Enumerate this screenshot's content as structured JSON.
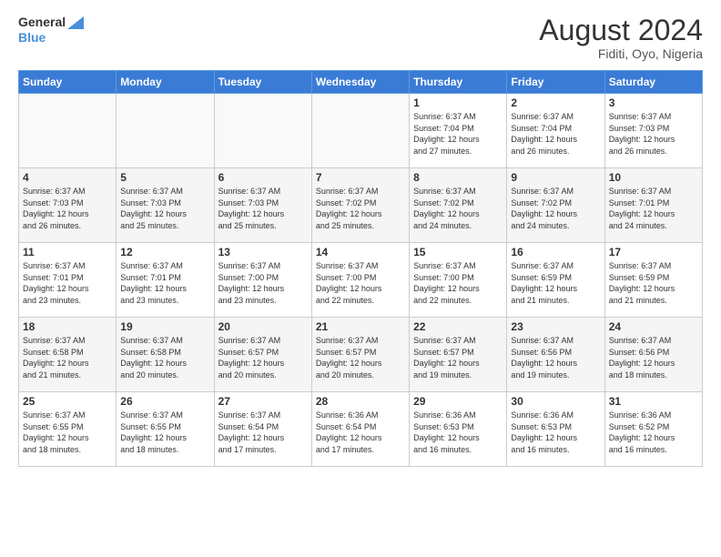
{
  "header": {
    "logo_line1": "General",
    "logo_line2": "Blue",
    "month_year": "August 2024",
    "location": "Fiditi, Oyo, Nigeria"
  },
  "weekdays": [
    "Sunday",
    "Monday",
    "Tuesday",
    "Wednesday",
    "Thursday",
    "Friday",
    "Saturday"
  ],
  "weeks": [
    [
      {
        "day": "",
        "info": ""
      },
      {
        "day": "",
        "info": ""
      },
      {
        "day": "",
        "info": ""
      },
      {
        "day": "",
        "info": ""
      },
      {
        "day": "1",
        "info": "Sunrise: 6:37 AM\nSunset: 7:04 PM\nDaylight: 12 hours\nand 27 minutes."
      },
      {
        "day": "2",
        "info": "Sunrise: 6:37 AM\nSunset: 7:04 PM\nDaylight: 12 hours\nand 26 minutes."
      },
      {
        "day": "3",
        "info": "Sunrise: 6:37 AM\nSunset: 7:03 PM\nDaylight: 12 hours\nand 26 minutes."
      }
    ],
    [
      {
        "day": "4",
        "info": "Sunrise: 6:37 AM\nSunset: 7:03 PM\nDaylight: 12 hours\nand 26 minutes."
      },
      {
        "day": "5",
        "info": "Sunrise: 6:37 AM\nSunset: 7:03 PM\nDaylight: 12 hours\nand 25 minutes."
      },
      {
        "day": "6",
        "info": "Sunrise: 6:37 AM\nSunset: 7:03 PM\nDaylight: 12 hours\nand 25 minutes."
      },
      {
        "day": "7",
        "info": "Sunrise: 6:37 AM\nSunset: 7:02 PM\nDaylight: 12 hours\nand 25 minutes."
      },
      {
        "day": "8",
        "info": "Sunrise: 6:37 AM\nSunset: 7:02 PM\nDaylight: 12 hours\nand 24 minutes."
      },
      {
        "day": "9",
        "info": "Sunrise: 6:37 AM\nSunset: 7:02 PM\nDaylight: 12 hours\nand 24 minutes."
      },
      {
        "day": "10",
        "info": "Sunrise: 6:37 AM\nSunset: 7:01 PM\nDaylight: 12 hours\nand 24 minutes."
      }
    ],
    [
      {
        "day": "11",
        "info": "Sunrise: 6:37 AM\nSunset: 7:01 PM\nDaylight: 12 hours\nand 23 minutes."
      },
      {
        "day": "12",
        "info": "Sunrise: 6:37 AM\nSunset: 7:01 PM\nDaylight: 12 hours\nand 23 minutes."
      },
      {
        "day": "13",
        "info": "Sunrise: 6:37 AM\nSunset: 7:00 PM\nDaylight: 12 hours\nand 23 minutes."
      },
      {
        "day": "14",
        "info": "Sunrise: 6:37 AM\nSunset: 7:00 PM\nDaylight: 12 hours\nand 22 minutes."
      },
      {
        "day": "15",
        "info": "Sunrise: 6:37 AM\nSunset: 7:00 PM\nDaylight: 12 hours\nand 22 minutes."
      },
      {
        "day": "16",
        "info": "Sunrise: 6:37 AM\nSunset: 6:59 PM\nDaylight: 12 hours\nand 21 minutes."
      },
      {
        "day": "17",
        "info": "Sunrise: 6:37 AM\nSunset: 6:59 PM\nDaylight: 12 hours\nand 21 minutes."
      }
    ],
    [
      {
        "day": "18",
        "info": "Sunrise: 6:37 AM\nSunset: 6:58 PM\nDaylight: 12 hours\nand 21 minutes."
      },
      {
        "day": "19",
        "info": "Sunrise: 6:37 AM\nSunset: 6:58 PM\nDaylight: 12 hours\nand 20 minutes."
      },
      {
        "day": "20",
        "info": "Sunrise: 6:37 AM\nSunset: 6:57 PM\nDaylight: 12 hours\nand 20 minutes."
      },
      {
        "day": "21",
        "info": "Sunrise: 6:37 AM\nSunset: 6:57 PM\nDaylight: 12 hours\nand 20 minutes."
      },
      {
        "day": "22",
        "info": "Sunrise: 6:37 AM\nSunset: 6:57 PM\nDaylight: 12 hours\nand 19 minutes."
      },
      {
        "day": "23",
        "info": "Sunrise: 6:37 AM\nSunset: 6:56 PM\nDaylight: 12 hours\nand 19 minutes."
      },
      {
        "day": "24",
        "info": "Sunrise: 6:37 AM\nSunset: 6:56 PM\nDaylight: 12 hours\nand 18 minutes."
      }
    ],
    [
      {
        "day": "25",
        "info": "Sunrise: 6:37 AM\nSunset: 6:55 PM\nDaylight: 12 hours\nand 18 minutes."
      },
      {
        "day": "26",
        "info": "Sunrise: 6:37 AM\nSunset: 6:55 PM\nDaylight: 12 hours\nand 18 minutes."
      },
      {
        "day": "27",
        "info": "Sunrise: 6:37 AM\nSunset: 6:54 PM\nDaylight: 12 hours\nand 17 minutes."
      },
      {
        "day": "28",
        "info": "Sunrise: 6:36 AM\nSunset: 6:54 PM\nDaylight: 12 hours\nand 17 minutes."
      },
      {
        "day": "29",
        "info": "Sunrise: 6:36 AM\nSunset: 6:53 PM\nDaylight: 12 hours\nand 16 minutes."
      },
      {
        "day": "30",
        "info": "Sunrise: 6:36 AM\nSunset: 6:53 PM\nDaylight: 12 hours\nand 16 minutes."
      },
      {
        "day": "31",
        "info": "Sunrise: 6:36 AM\nSunset: 6:52 PM\nDaylight: 12 hours\nand 16 minutes."
      }
    ]
  ]
}
